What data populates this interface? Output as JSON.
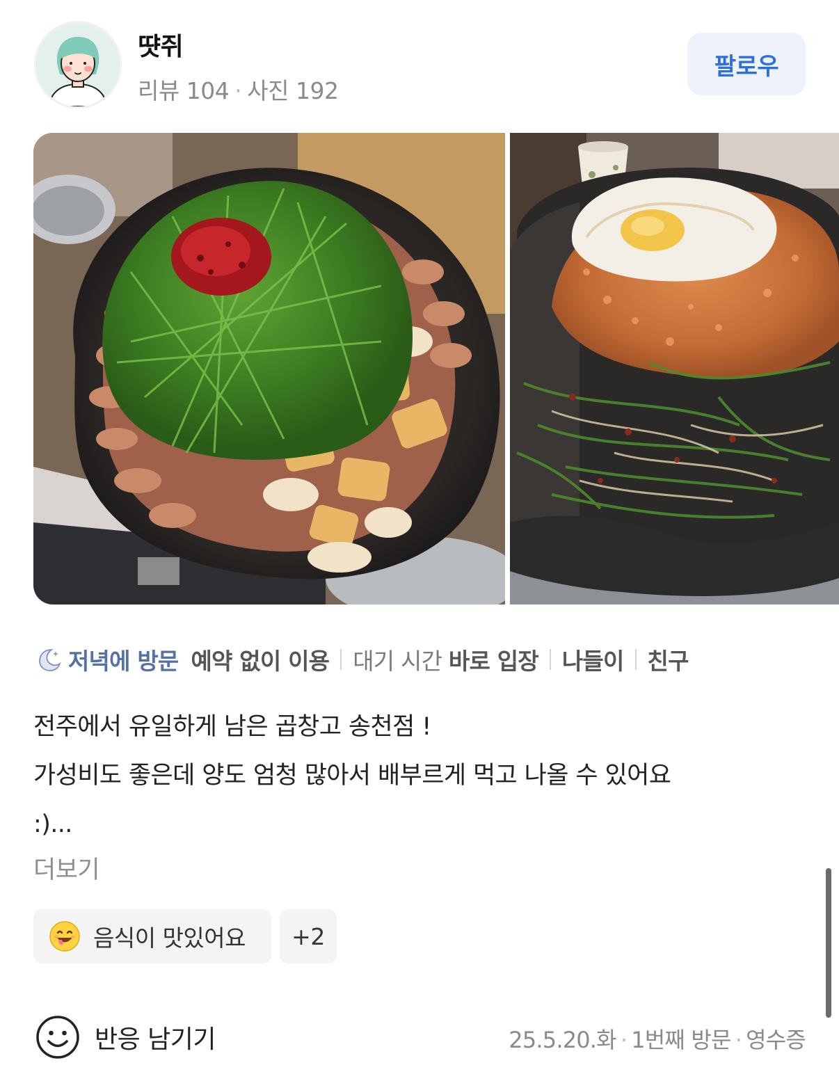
{
  "user": {
    "name": "땻쥐",
    "review_label": "리뷰",
    "review_count": "104",
    "photo_label": "사진",
    "photo_count": "192",
    "separator": "·",
    "follow_label": "팔로우"
  },
  "photos": [
    {
      "icon": "food-photo-gopchang"
    },
    {
      "icon": "food-photo-fried-rice"
    }
  ],
  "visit": {
    "time": "저녁에 방문",
    "tags": [
      {
        "label": "",
        "value": "예약 없이 이용"
      },
      {
        "label": "대기 시간",
        "value": "바로 입장"
      },
      {
        "label": "",
        "value": "나들이"
      },
      {
        "label": "",
        "value": "친구"
      }
    ]
  },
  "review": {
    "lines": [
      "전주에서 유일하게 남은 곱창고 송천점 !",
      "가성비도 좋은데 양도 엄청 많아서 배부르게 먹고 나올 수 있어요",
      ":)..."
    ],
    "more_label": "더보기"
  },
  "keywords": {
    "main": "음식이 맛있어요",
    "more": "+2"
  },
  "footer": {
    "reaction_label": "반응 남기기",
    "date": "25.5.20.화",
    "visit_order": "1번째 방문",
    "receipt": "영수증",
    "separator": "·"
  },
  "colors": {
    "follow_text": "#2e6fe0",
    "follow_bg": "#eef3fb",
    "visit_time": "#5470a8"
  }
}
